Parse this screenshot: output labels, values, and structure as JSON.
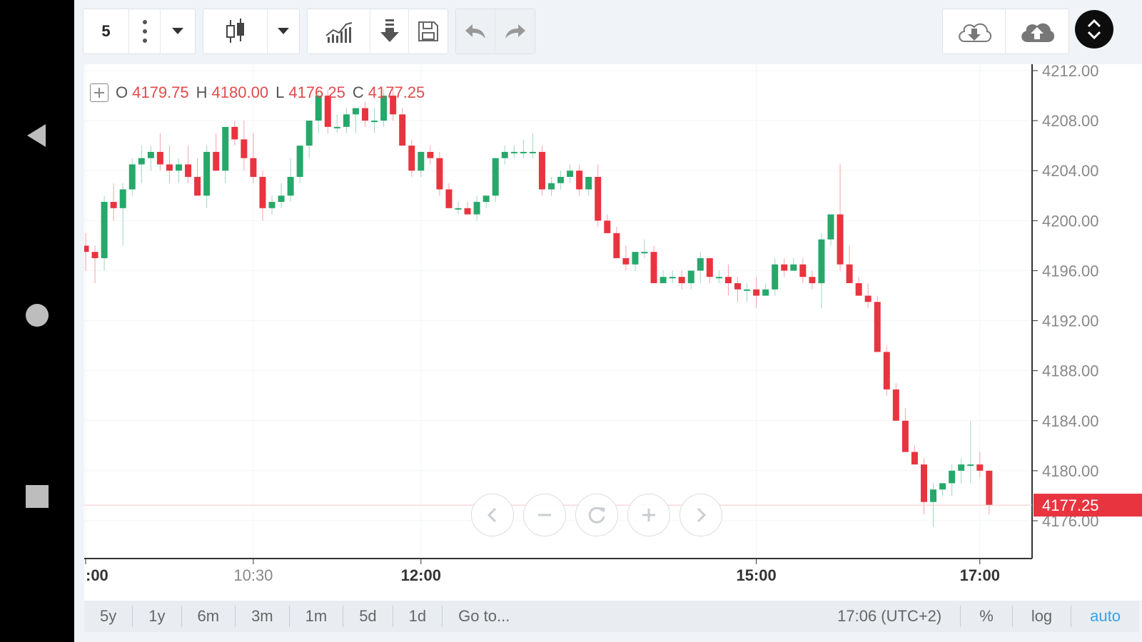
{
  "toolbar": {
    "interval": "5",
    "icons": [
      "more-vertical-icon",
      "dropdown-icon",
      "candlestick-icon",
      "dropdown-icon",
      "indicators-icon",
      "download-icon",
      "save-icon",
      "undo-icon",
      "redo-icon",
      "cloud-download-icon",
      "cloud-upload-icon",
      "expand-collapse-icon"
    ]
  },
  "legend": {
    "open_label": "O",
    "open": "4179.75",
    "high_label": "H",
    "high": "4180.00",
    "low_label": "L",
    "low": "4176.25",
    "close_label": "C",
    "close": "4177.25"
  },
  "footer": {
    "ranges": [
      "5y",
      "1y",
      "6m",
      "3m",
      "1m",
      "5d",
      "1d",
      "Go to..."
    ],
    "time": "17:06 (UTC+2)",
    "percent": "%",
    "log": "log",
    "auto": "auto"
  },
  "colors": {
    "up": "#26a86a",
    "down": "#e8343f",
    "price_tag": "#e8343f",
    "auto": "#3aa0e6"
  },
  "chart_data": {
    "type": "candlestick",
    "symbol_interval": "5",
    "current_price": "4177.25",
    "ylim": [
      4174,
      4212
    ],
    "yticks": [
      "4212.00",
      "4208.00",
      "4204.00",
      "4200.00",
      "4196.00",
      "4192.00",
      "4188.00",
      "4184.00",
      "4180.00",
      "4176.00"
    ],
    "xticks": [
      {
        "label": ":00",
        "i": 0
      },
      {
        "label": "10:30",
        "i": 18
      },
      {
        "label": "12:00",
        "i": 36
      },
      {
        "label": "15:00",
        "i": 72
      },
      {
        "label": "17:00",
        "i": 96
      }
    ],
    "candles": [
      [
        4198,
        4199,
        4196,
        4197.5
      ],
      [
        4197.5,
        4198,
        4195,
        4197
      ],
      [
        4197,
        4202,
        4196,
        4201.5
      ],
      [
        4201.5,
        4203,
        4200,
        4201
      ],
      [
        4201,
        4203,
        4198,
        4202.5
      ],
      [
        4202.5,
        4205,
        4202,
        4204.5
      ],
      [
        4204.5,
        4206,
        4203,
        4205
      ],
      [
        4205,
        4206,
        4204,
        4205.5
      ],
      [
        4205.5,
        4207,
        4204,
        4204.5
      ],
      [
        4204.5,
        4206,
        4203,
        4204
      ],
      [
        4204,
        4205,
        4203,
        4204.5
      ],
      [
        4204.5,
        4206,
        4203,
        4203.5
      ],
      [
        4203.5,
        4205,
        4202,
        4202
      ],
      [
        4202,
        4206,
        4201,
        4205.5
      ],
      [
        4205.5,
        4207,
        4204,
        4204
      ],
      [
        4204,
        4206,
        4203,
        4207.5
      ],
      [
        4207.5,
        4208,
        4206,
        4206.5
      ],
      [
        4206.5,
        4208,
        4204,
        4205
      ],
      [
        4205,
        4207,
        4203,
        4203.5
      ],
      [
        4203.5,
        4204,
        4200,
        4201
      ],
      [
        4201,
        4202,
        4200.5,
        4201.5
      ],
      [
        4201.5,
        4203,
        4201,
        4202
      ],
      [
        4202,
        4205,
        4201.5,
        4203.5
      ],
      [
        4203.5,
        4206,
        4203,
        4206
      ],
      [
        4206,
        4208,
        4205,
        4208
      ],
      [
        4208,
        4210.5,
        4207,
        4210
      ],
      [
        4210,
        4210.5,
        4207,
        4207.5
      ],
      [
        4207.5,
        4208.5,
        4207,
        4207.5
      ],
      [
        4207.5,
        4209,
        4207,
        4208.5
      ],
      [
        4208.5,
        4209,
        4207,
        4209
      ],
      [
        4209,
        4209.5,
        4207.5,
        4208
      ],
      [
        4208,
        4209,
        4207,
        4208
      ],
      [
        4208,
        4210.5,
        4207.5,
        4210
      ],
      [
        4210,
        4210.5,
        4208,
        4208.5
      ],
      [
        4208.5,
        4209,
        4206,
        4206
      ],
      [
        4206,
        4206.5,
        4203.5,
        4204
      ],
      [
        4204,
        4205.5,
        4203.5,
        4205.5
      ],
      [
        4205.5,
        4206,
        4204.5,
        4205
      ],
      [
        4205,
        4205.5,
        4202,
        4202.5
      ],
      [
        4202.5,
        4203,
        4201,
        4201
      ],
      [
        4201,
        4201.5,
        4200.5,
        4201
      ],
      [
        4201,
        4201.5,
        4200.5,
        4200.5
      ],
      [
        4200.5,
        4202,
        4200,
        4201.5
      ],
      [
        4201.5,
        4202,
        4201,
        4202
      ],
      [
        4202,
        4205,
        4201.5,
        4205
      ],
      [
        4205,
        4206,
        4204.5,
        4205.5
      ],
      [
        4205.5,
        4206,
        4205,
        4205.5
      ],
      [
        4205.5,
        4206.5,
        4205,
        4205.5
      ],
      [
        4205.5,
        4207,
        4205,
        4205.5
      ],
      [
        4205.5,
        4206,
        4202,
        4202.5
      ],
      [
        4202.5,
        4203.5,
        4202,
        4203
      ],
      [
        4203,
        4204,
        4202.5,
        4203.5
      ],
      [
        4203.5,
        4204.5,
        4203,
        4204
      ],
      [
        4204,
        4204.5,
        4202,
        4202.5
      ],
      [
        4202.5,
        4203.5,
        4202,
        4203.5
      ],
      [
        4203.5,
        4204.5,
        4199.5,
        4200
      ],
      [
        4200,
        4200.5,
        4199,
        4199
      ],
      [
        4199,
        4199.5,
        4197,
        4197
      ],
      [
        4197,
        4198,
        4196,
        4196.5
      ],
      [
        4196.5,
        4197.5,
        4196,
        4197.5
      ],
      [
        4197.5,
        4198.5,
        4197,
        4197.5
      ],
      [
        4197.5,
        4198,
        4195,
        4195
      ],
      [
        4195,
        4196,
        4195,
        4195.5
      ],
      [
        4195.5,
        4196,
        4195,
        4195.5
      ],
      [
        4195.5,
        4196,
        4194.5,
        4195
      ],
      [
        4195,
        4196,
        4194.5,
        4196
      ],
      [
        4196,
        4197.5,
        4195,
        4197
      ],
      [
        4197,
        4197,
        4195,
        4195.5
      ],
      [
        4195.5,
        4196,
        4195,
        4195.5
      ],
      [
        4195.5,
        4196.5,
        4194,
        4195
      ],
      [
        4195,
        4195.5,
        4193.5,
        4194.5
      ],
      [
        4194.5,
        4195,
        4193.5,
        4194.5
      ],
      [
        4194.5,
        4195.5,
        4193,
        4194
      ],
      [
        4194,
        4195,
        4194,
        4194.5
      ],
      [
        4194.5,
        4197,
        4194,
        4196.5
      ],
      [
        4196.5,
        4197,
        4195.5,
        4196
      ],
      [
        4196,
        4197,
        4196,
        4196.5
      ],
      [
        4196.5,
        4197,
        4195,
        4195.5
      ],
      [
        4195.5,
        4196,
        4194.5,
        4195
      ],
      [
        4195,
        4199,
        4193,
        4198.5
      ],
      [
        4198.5,
        4200.5,
        4198,
        4200.5
      ],
      [
        4200.5,
        4204.5,
        4196,
        4196.5
      ],
      [
        4196.5,
        4198,
        4195,
        4195
      ],
      [
        4195,
        4195.5,
        4194,
        4194
      ],
      [
        4194,
        4195,
        4193,
        4193.5
      ],
      [
        4193.5,
        4194,
        4189.5,
        4189.5
      ],
      [
        4189.5,
        4190,
        4186,
        4186.5
      ],
      [
        4186.5,
        4187,
        4184,
        4184
      ],
      [
        4184,
        4185,
        4181.5,
        4181.5
      ],
      [
        4181.5,
        4182,
        4180.5,
        4180.5
      ],
      [
        4180.5,
        4181,
        4176.5,
        4177.5
      ],
      [
        4177.5,
        4179,
        4175.5,
        4178.5
      ],
      [
        4178.5,
        4179,
        4178,
        4179
      ],
      [
        4179,
        4180.5,
        4178,
        4180
      ],
      [
        4180,
        4181,
        4179,
        4180.5
      ],
      [
        4180.5,
        4184,
        4179,
        4180.5
      ],
      [
        4180.5,
        4181.5,
        4179.5,
        4180
      ],
      [
        4180,
        4180,
        4176.5,
        4177.25
      ]
    ]
  }
}
